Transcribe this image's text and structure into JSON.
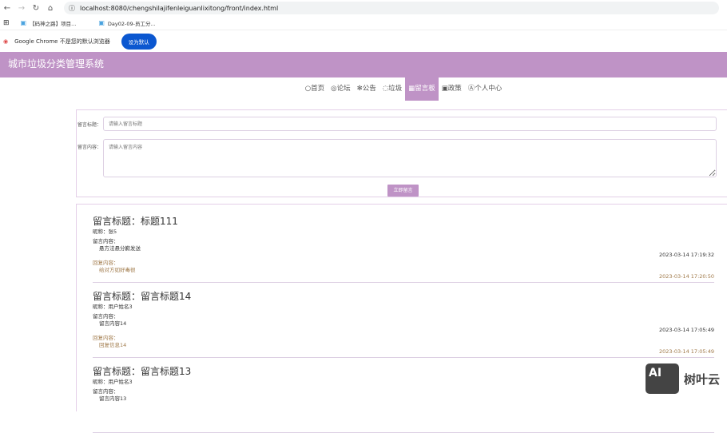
{
  "browser": {
    "url": "localhost:8080/chengshilajifenleiguanlixitong/front/index.html",
    "bookmarks": [
      "【码神之路】项目...",
      "Day02-09-员工分..."
    ],
    "infobar_text": "Google Chrome 不是您的默认浏览器",
    "infobar_button": "设为默认"
  },
  "header": {
    "title": "城市垃圾分类管理系统"
  },
  "nav": [
    {
      "icon": "○",
      "label": "首页"
    },
    {
      "icon": "◎",
      "label": "论坛"
    },
    {
      "icon": "✻",
      "label": "公告"
    },
    {
      "icon": "◌",
      "label": "垃圾"
    },
    {
      "icon": "▦",
      "label": "留言板",
      "active": true
    },
    {
      "icon": "▣",
      "label": "政策"
    },
    {
      "icon": "Ⓐ",
      "label": "个人中心"
    }
  ],
  "form": {
    "title_label": "留言标题：",
    "title_placeholder": "请输入留言标题",
    "content_label": "留言内容：",
    "content_placeholder": "请输入留言内容",
    "submit": "立即留言"
  },
  "messages": [
    {
      "title": "留言标题：标题111",
      "nickname": "昵称：张5",
      "content_label": "留言内容：",
      "content": "悬方法悬分歉发送",
      "time": "2023-03-14 17:19:32",
      "reply_label": "回复内容：",
      "reply": "给对方如好毒很",
      "reply_time": "2023-03-14 17:20:50"
    },
    {
      "title": "留言标题：留言标题14",
      "nickname": "昵称：用户姓名3",
      "content_label": "留言内容：",
      "content": "留言内容14",
      "time": "2023-03-14 17:05:49",
      "reply_label": "回复内容：",
      "reply": "回复信息14",
      "reply_time": "2023-03-14 17:05:49"
    },
    {
      "title": "留言标题：留言标题13",
      "nickname": "昵称：用户姓名3",
      "content_label": "留言内容：",
      "content": "留言内容13"
    }
  ],
  "watermark": {
    "logo": "AI",
    "text": "树叶云"
  }
}
